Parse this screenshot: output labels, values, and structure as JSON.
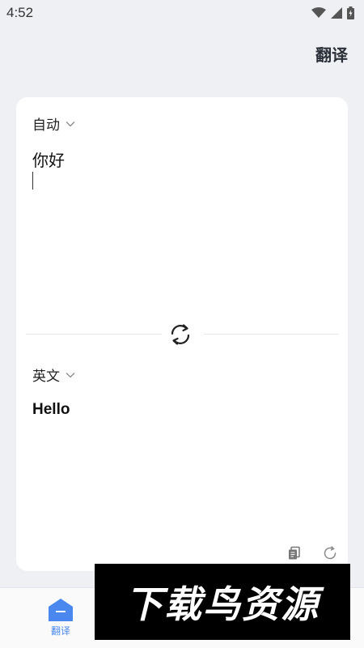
{
  "status_bar": {
    "time": "4:52"
  },
  "header": {
    "title": "翻译"
  },
  "source": {
    "language": "自动",
    "text": "你好"
  },
  "target": {
    "language": "英文",
    "text": "Hello"
  },
  "bottom_nav": {
    "items": [
      {
        "label": "翻译",
        "icon": "translate-home-icon",
        "active": true
      }
    ]
  },
  "watermark": {
    "text": "下载鸟资源"
  },
  "colors": {
    "accent": "#4a88f0",
    "background": "#eef0f4",
    "card": "#ffffff"
  }
}
